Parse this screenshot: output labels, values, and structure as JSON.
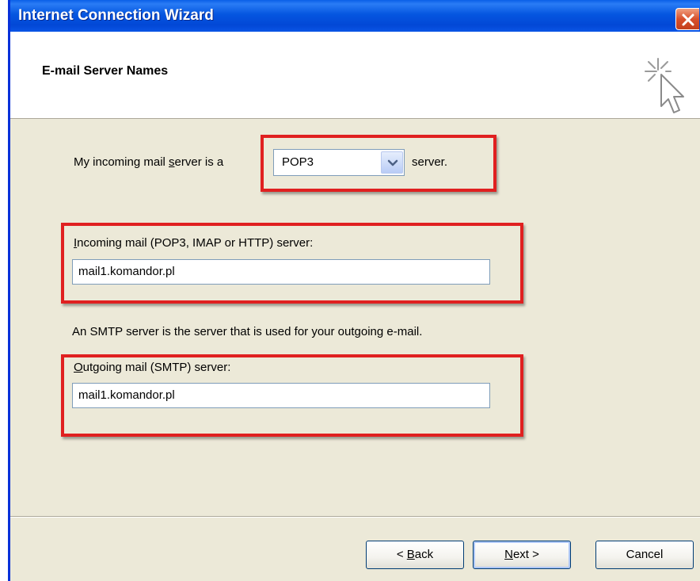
{
  "window": {
    "title": "Internet Connection Wizard"
  },
  "header": {
    "title": "E-mail Server Names"
  },
  "server_type": {
    "label_before": "My incoming mail ",
    "label_mnemonic": "s",
    "label_after": "erver is a",
    "selected": "POP3",
    "suffix": "server."
  },
  "incoming": {
    "label_mnemonic": "I",
    "label_rest": "ncoming mail (POP3, IMAP or HTTP) server:",
    "value": "mail1.komandor.pl"
  },
  "smtp_info": "An SMTP server is the server that is used for your outgoing e-mail.",
  "outgoing": {
    "label_mnemonic": "O",
    "label_rest": "utgoing mail (SMTP) server:",
    "value": "mail1.komandor.pl"
  },
  "buttons": {
    "back_prefix": "< ",
    "back_mnemonic": "B",
    "back_rest": "ack",
    "next_mnemonic": "N",
    "next_rest": "ext >",
    "cancel": "Cancel"
  },
  "icons": {
    "close": "close-icon",
    "wizard": "cursor-sparkle-icon",
    "dropdown": "chevron-down-icon"
  },
  "colors": {
    "titlebar": "#0556e0",
    "dialog_bg": "#ece9d8",
    "highlight": "#e02020",
    "close_button": "#d8502c"
  }
}
